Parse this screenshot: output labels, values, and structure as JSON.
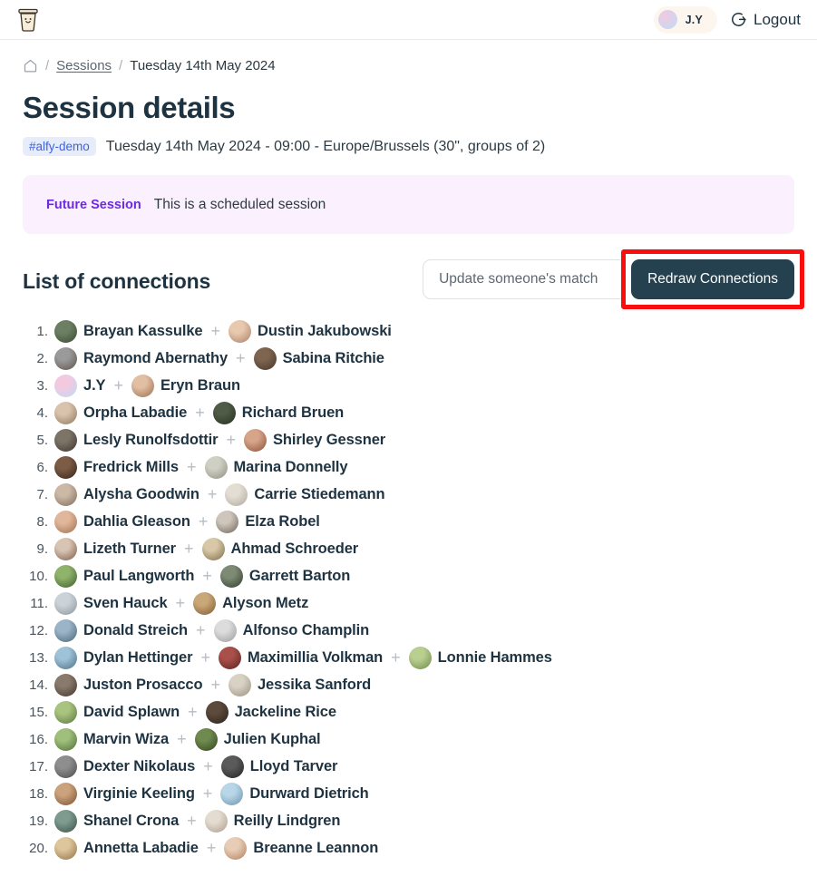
{
  "header": {
    "logo_icon": "coffee-cup-logo",
    "user": {
      "name": "J.Y",
      "avatar_colors": [
        "#f3c9e0",
        "#bcdcf5"
      ]
    },
    "logout_label": "Logout",
    "logout_icon": "logout-icon"
  },
  "breadcrumb": {
    "home_icon": "home-icon",
    "separator": "/",
    "items": [
      {
        "label": "Sessions",
        "link": true
      },
      {
        "label": "Tuesday 14th May 2024",
        "link": false
      }
    ]
  },
  "page": {
    "title": "Session details",
    "tag": "#alfy-demo",
    "subtitle": "Tuesday 14th May 2024 - 09:00 - Europe/Brussels (30\", groups of 2)"
  },
  "notice": {
    "label": "Future Session",
    "text": "This is a scheduled session",
    "background": "#faf0fe",
    "label_color": "#6d2ae2"
  },
  "section": {
    "title": "List of connections",
    "match_placeholder": "Update someone's match",
    "match_value": "",
    "redraw_label": "Redraw Connections",
    "redraw_bg": "#25404e",
    "highlight_color": "#f90d0d"
  },
  "connections": [
    {
      "index": "1.",
      "people": [
        {
          "name": "Brayan Kassulke",
          "c1": "#6d7f63",
          "c2": "#3d4a36"
        },
        {
          "name": "Dustin Jakubowski",
          "c1": "#e8c9ae",
          "c2": "#a8806a"
        }
      ]
    },
    {
      "index": "2.",
      "people": [
        {
          "name": "Raymond Abernathy",
          "c1": "#9a9a9a",
          "c2": "#5e5249"
        },
        {
          "name": "Sabina Ritchie",
          "c1": "#7d6550",
          "c2": "#463629"
        }
      ]
    },
    {
      "index": "3.",
      "people": [
        {
          "name": "J.Y",
          "c1": "#f3c9e0",
          "c2": "#bcdcf5"
        },
        {
          "name": "Eryn Braun",
          "c1": "#e2bfa3",
          "c2": "#9c6e52"
        }
      ]
    },
    {
      "index": "4.",
      "people": [
        {
          "name": "Orpha Labadie",
          "c1": "#d9c3ad",
          "c2": "#8d7660"
        },
        {
          "name": "Richard Bruen",
          "c1": "#4f5b46",
          "c2": "#23301f"
        }
      ]
    },
    {
      "index": "5.",
      "people": [
        {
          "name": "Lesly Runolfsdottir",
          "c1": "#7d7468",
          "c2": "#3c352d"
        },
        {
          "name": "Shirley Gessner",
          "c1": "#d6a489",
          "c2": "#8a4f36"
        }
      ]
    },
    {
      "index": "6.",
      "people": [
        {
          "name": "Fredrick Mills",
          "c1": "#7d5c45",
          "c2": "#32231a"
        },
        {
          "name": "Marina Donnelly",
          "c1": "#cfcfc4",
          "c2": "#8e9080"
        }
      ]
    },
    {
      "index": "7.",
      "people": [
        {
          "name": "Alysha Goodwin",
          "c1": "#cbb9a5",
          "c2": "#7d6c5c"
        },
        {
          "name": "Carrie Stiedemann",
          "c1": "#e3ddd4",
          "c2": "#b0a89c"
        }
      ]
    },
    {
      "index": "8.",
      "people": [
        {
          "name": "Dahlia Gleason",
          "c1": "#e0b79b",
          "c2": "#a06e50"
        },
        {
          "name": "Elza Robel",
          "c1": "#cfc6bb",
          "c2": "#6d6257"
        }
      ]
    },
    {
      "index": "9.",
      "people": [
        {
          "name": "Lizeth Turner",
          "c1": "#d8c4b3",
          "c2": "#7a5a47"
        },
        {
          "name": "Ahmad Schroeder",
          "c1": "#d8c8a8",
          "c2": "#7d6a45"
        }
      ]
    },
    {
      "index": "10.",
      "people": [
        {
          "name": "Paul Langworth",
          "c1": "#8fb36b",
          "c2": "#3f5c2c"
        },
        {
          "name": "Garrett Barton",
          "c1": "#7d8a74",
          "c2": "#313b2b"
        }
      ]
    },
    {
      "index": "11.",
      "people": [
        {
          "name": "Sven Hauck",
          "c1": "#ccd3d8",
          "c2": "#8b949c"
        },
        {
          "name": "Alyson Metz",
          "c1": "#c9a777",
          "c2": "#7d5a33"
        }
      ]
    },
    {
      "index": "12.",
      "people": [
        {
          "name": "Donald Streich",
          "c1": "#9bb4c7",
          "c2": "#4a6374"
        },
        {
          "name": "Alfonso Champlin",
          "c1": "#dcdcdc",
          "c2": "#9a9a9a"
        }
      ]
    },
    {
      "index": "13.",
      "people": [
        {
          "name": "Dylan Hettinger",
          "c1": "#9ec2d8",
          "c2": "#4e6d82"
        },
        {
          "name": "Maximillia Volkman",
          "c1": "#a9504a",
          "c2": "#5a211e"
        },
        {
          "name": "Lonnie Hammes",
          "c1": "#b9cf8f",
          "c2": "#6d8a4a"
        }
      ]
    },
    {
      "index": "14.",
      "people": [
        {
          "name": "Juston Prosacco",
          "c1": "#8a7a6d",
          "c2": "#3f342b"
        },
        {
          "name": "Jessika Sanford",
          "c1": "#d7d2c4",
          "c2": "#9a9181"
        }
      ]
    },
    {
      "index": "15.",
      "people": [
        {
          "name": "David Splawn",
          "c1": "#a9c47e",
          "c2": "#5b7340"
        },
        {
          "name": "Jackeline Rice",
          "c1": "#5c4a3c",
          "c2": "#2b2119"
        }
      ]
    },
    {
      "index": "16.",
      "people": [
        {
          "name": "Marvin Wiza",
          "c1": "#9fbf7a",
          "c2": "#4f6b38"
        },
        {
          "name": "Julien Kuphal",
          "c1": "#6f8a4f",
          "c2": "#33441f"
        }
      ]
    },
    {
      "index": "17.",
      "people": [
        {
          "name": "Dexter Nikolaus",
          "c1": "#8e8e8e",
          "c2": "#4a4a4a"
        },
        {
          "name": "Lloyd Tarver",
          "c1": "#5a5a5a",
          "c2": "#222222"
        }
      ]
    },
    {
      "index": "18.",
      "people": [
        {
          "name": "Virginie Keeling",
          "c1": "#caa27c",
          "c2": "#7a4f30"
        },
        {
          "name": "Durward Dietrich",
          "c1": "#b9d6e8",
          "c2": "#6a93ad"
        }
      ]
    },
    {
      "index": "19.",
      "people": [
        {
          "name": "Shanel Crona",
          "c1": "#7d9b8e",
          "c2": "#3a4f47"
        },
        {
          "name": "Reilly Lindgren",
          "c1": "#e4dcd0",
          "c2": "#aa9c8c"
        }
      ]
    },
    {
      "index": "20.",
      "people": [
        {
          "name": "Annetta Labadie",
          "c1": "#ddc59c",
          "c2": "#8f7246"
        },
        {
          "name": "Breanne Leannon",
          "c1": "#e8cdb6",
          "c2": "#b07f5c"
        }
      ]
    }
  ]
}
